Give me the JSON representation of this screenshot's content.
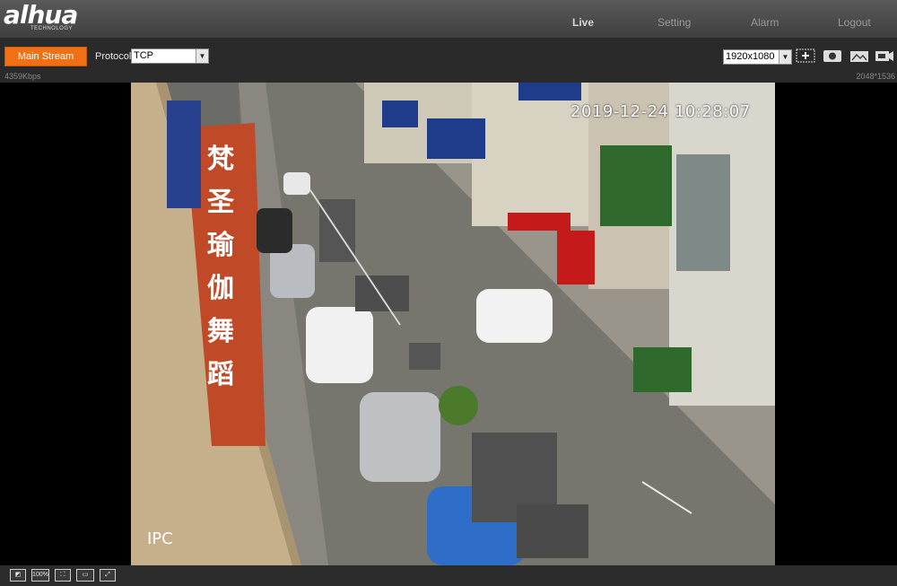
{
  "brand": {
    "logo": "alhua",
    "tagline": "TECHNOLOGY"
  },
  "nav": {
    "live": "Live",
    "setting": "Setting",
    "alarm": "Alarm",
    "logout": "Logout"
  },
  "toolbar": {
    "main_stream": "Main Stream",
    "protocol_label": "Protocol",
    "protocol_value": "TCP",
    "resolution_value": "1920x1080",
    "icons": [
      "zoom-region-icon",
      "snapshot-icon",
      "triple-snapshot-icon",
      "record-icon"
    ]
  },
  "status": {
    "bitrate": "4359Kbps",
    "stream_resolution": "2048*1536"
  },
  "video": {
    "timestamp": "2019-12-24 10:28:07",
    "channel_title": "IPC",
    "sign_text": [
      "梵",
      "圣",
      "瑜",
      "伽",
      "舞",
      "蹈"
    ]
  },
  "bottom": {
    "zoom_label": "100%",
    "icons": [
      "image-adjust-icon",
      "original-size-icon",
      "fit-window-icon",
      "width-height-icon",
      "fullscreen-icon"
    ]
  }
}
